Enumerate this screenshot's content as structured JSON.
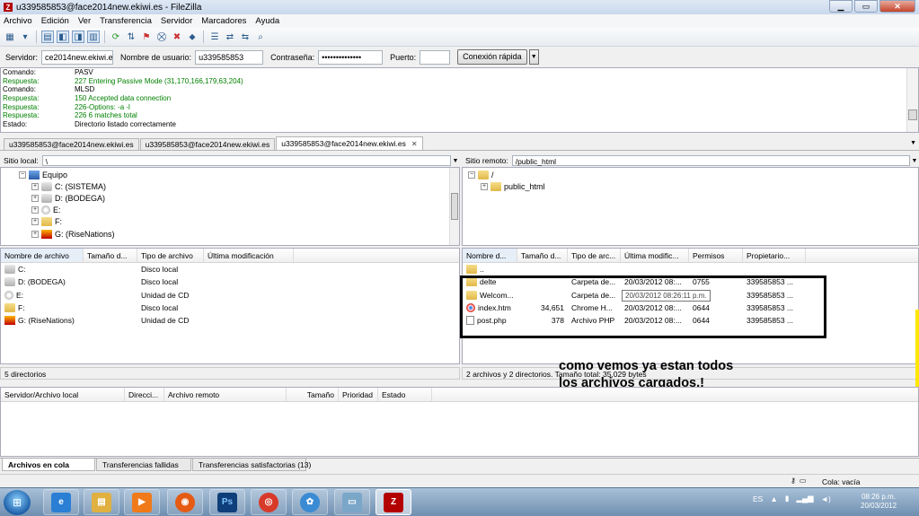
{
  "window": {
    "title": "u339585853@face2014new.ekiwi.es - FileZilla",
    "app_glyph": "Z"
  },
  "menu": [
    "Archivo",
    "Edición",
    "Ver",
    "Transferencia",
    "Servidor",
    "Marcadores",
    "Ayuda"
  ],
  "quickconnect": {
    "server_label": "Servidor:",
    "server_value": "ce2014new.ekiwi.es",
    "user_label": "Nombre de usuario:",
    "user_value": "u339585853",
    "password_label": "Contraseña:",
    "password_value": "••••••••••••••",
    "port_label": "Puerto:",
    "port_value": "",
    "connect_label": "Conexión rápida"
  },
  "log": [
    {
      "key": "Comando:",
      "value": "PASV",
      "type": "cmd"
    },
    {
      "key": "Respuesta:",
      "value": "227 Entering Passive Mode (31,170,166,179,63,204)",
      "type": "resp"
    },
    {
      "key": "Comando:",
      "value": "MLSD",
      "type": "cmd"
    },
    {
      "key": "Respuesta:",
      "value": "150 Accepted data connection",
      "type": "resp"
    },
    {
      "key": "Respuesta:",
      "value": "226-Options: -a -l",
      "type": "resp"
    },
    {
      "key": "Respuesta:",
      "value": "226 6 matches total",
      "type": "resp"
    },
    {
      "key": "Estado:",
      "value": "Directorio listado correctamente",
      "type": "status"
    }
  ],
  "tabs": [
    {
      "label": "u339585853@face2014new.ekiwi.es"
    },
    {
      "label": "u339585853@face2014new.ekiwi.es"
    },
    {
      "label": "u339585853@face2014new.ekiwi.es",
      "close": "✕"
    }
  ],
  "local": {
    "site_label": "Sitio local:",
    "path": "\\",
    "tree": {
      "root": "Equipo",
      "drives": [
        "C: (SISTEMA)",
        "D: (BODEGA)",
        "E:",
        "F:",
        "G: (RiseNations)"
      ]
    },
    "columns": [
      "Nombre de archivo",
      "Tamaño d...",
      "Tipo de archivo",
      "Última modificación"
    ],
    "rows": [
      {
        "name": "C:",
        "type": "Disco local",
        "icon": "drive"
      },
      {
        "name": "D: (BODEGA)",
        "type": "Disco local",
        "icon": "drive"
      },
      {
        "name": "E:",
        "type": "Unidad de CD",
        "icon": "cd"
      },
      {
        "name": "F:",
        "type": "Disco local",
        "icon": "drive"
      },
      {
        "name": "G: (RiseNations)",
        "type": "Unidad de CD",
        "icon": "game"
      }
    ],
    "status": "5 directorios"
  },
  "remote": {
    "site_label": "Sitio remoto:",
    "path": "/public_html",
    "tree": {
      "root": "/",
      "child": "public_html"
    },
    "columns": [
      "Nombre d...",
      "Tamaño d...",
      "Tipo de arc...",
      "Última modific...",
      "Permisos",
      "Propietario..."
    ],
    "rows": [
      {
        "name": "..",
        "size": "",
        "type": "",
        "modified": "",
        "perm": "",
        "owner": "",
        "icon": "folder"
      },
      {
        "name": "delte",
        "size": "",
        "type": "Carpeta de...",
        "modified": "20/03/2012 08:...",
        "perm": "0755",
        "owner": "339585853 ...",
        "icon": "folder"
      },
      {
        "name": "Welcom...",
        "size": "",
        "type": "Carpeta de...",
        "modified": "",
        "perm": "",
        "owner": "339585853 ...",
        "icon": "folder"
      },
      {
        "name": "index.htm",
        "size": "34,651",
        "type": "Chrome H...",
        "modified": "20/03/2012 08:...",
        "perm": "0644",
        "owner": "339585853 ...",
        "icon": "chrome"
      },
      {
        "name": "post.php",
        "size": "378",
        "type": "Archivo PHP",
        "modified": "20/03/2012 08:...",
        "perm": "0644",
        "owner": "339585853 ...",
        "icon": "file"
      }
    ],
    "tooltip": "20/03/2012 08:26:11 p.m.",
    "status": "2 archivos y 2 directorios. Tamaño total: 35,029 bytes"
  },
  "annotation": {
    "line1": "como vemos ya estan todos",
    "line2": "los archivos cargados.!"
  },
  "queue": {
    "columns": [
      "Servidor/Archivo local",
      "Direcci...",
      "Archivo remoto",
      "Tamaño",
      "Prioridad",
      "Estado"
    ]
  },
  "queue_tabs": [
    "Archivos en cola",
    "Transferencias fallidas",
    "Transferencias satisfactorias (13)"
  ],
  "app_status": {
    "queue": "Cola: vacía"
  },
  "taskbar": {
    "lang": "ES",
    "time": "08:26 p.m.",
    "date": "20/03/2012",
    "apps": [
      {
        "name": "internet-explorer",
        "glyph": "e",
        "color": "#2a7fd4"
      },
      {
        "name": "file-explorer",
        "glyph": "▤",
        "color": "#e0b040"
      },
      {
        "name": "media-player",
        "glyph": "▶",
        "color": "#f07a1a"
      },
      {
        "name": "firefox",
        "glyph": "◉",
        "color": "#e55b14"
      },
      {
        "name": "photoshop",
        "glyph": "Ps",
        "color": "#0f3f7a"
      },
      {
        "name": "chrome",
        "glyph": "◎",
        "color": "#d83a2a"
      },
      {
        "name": "messenger",
        "glyph": "✿",
        "color": "#3a8ad4"
      },
      {
        "name": "notepad",
        "glyph": "▭",
        "color": "#7aa6c8"
      },
      {
        "name": "filezilla",
        "glyph": "Z",
        "color": "#b30000",
        "active": true
      }
    ]
  },
  "colors": {
    "log_green": "#008000",
    "taskbar": "#6f8fb0",
    "highlight": "#000000"
  }
}
